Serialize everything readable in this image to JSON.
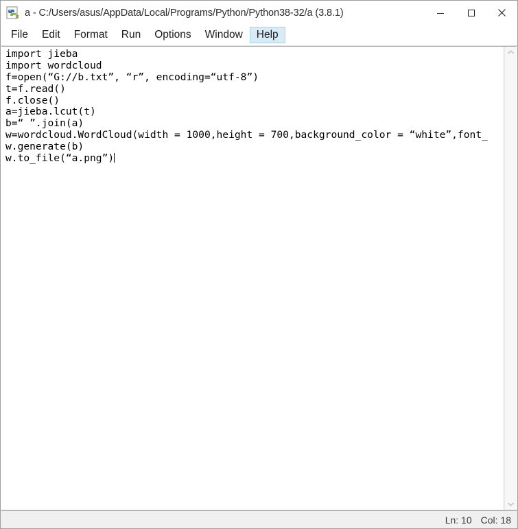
{
  "window": {
    "title": "a - C:/Users/asus/AppData/Local/Programs/Python/Python38-32/a (3.8.1)",
    "icon": "python-idle-icon",
    "controls": {
      "minimize_label": "—",
      "maximize_label": "☐",
      "close_label": "✕"
    }
  },
  "menubar": {
    "items": [
      {
        "label": "File",
        "active": false
      },
      {
        "label": "Edit",
        "active": false
      },
      {
        "label": "Format",
        "active": false
      },
      {
        "label": "Run",
        "active": false
      },
      {
        "label": "Options",
        "active": false
      },
      {
        "label": "Window",
        "active": false
      },
      {
        "label": "Help",
        "active": true
      }
    ]
  },
  "editor": {
    "lines": [
      "import jieba",
      "import wordcloud",
      "f=open(“G://b.txt”, “r”, encoding=“utf-8”)",
      "t=f.read()",
      "f.close()",
      "a=jieba.lcut(t)",
      "b=“ ”.join(a)",
      "w=wordcloud.WordCloud(width = 1000,height = 700,background_color = “white”,font_",
      "w.generate(b)",
      "w.to_file(“a.png”)"
    ],
    "caret_line_index": 9
  },
  "scrollbar": {
    "up_arrow": "chevron-up-icon",
    "down_arrow": "chevron-down-icon"
  },
  "statusbar": {
    "line_label": "Ln: 10",
    "col_label": "Col: 18"
  },
  "colors": {
    "menu_highlight_bg": "#d9ebf7",
    "menu_highlight_border": "#a8d2ea",
    "statusbar_bg": "#f0f0f0",
    "editor_bg": "#ffffff",
    "text": "#000000"
  }
}
